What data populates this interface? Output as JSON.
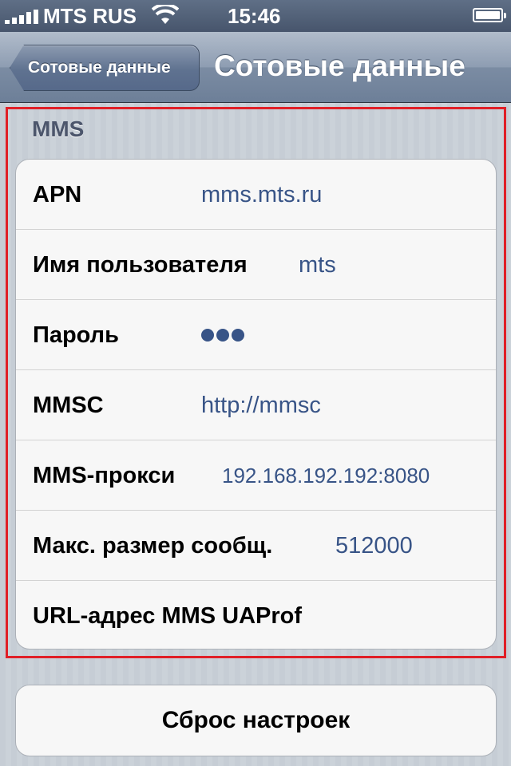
{
  "status_bar": {
    "carrier": "MTS RUS",
    "time": "15:46",
    "signal_icon": "signal-bars-icon",
    "wifi_icon": "wifi-icon",
    "battery_level": 1.0
  },
  "nav": {
    "back_label": "Сотовые данные",
    "title": "Сотовые данные"
  },
  "section": {
    "header": "MMS",
    "rows": [
      {
        "label": "APN",
        "value": "mms.mts.ru"
      },
      {
        "label": "Имя пользователя",
        "value": "mts"
      },
      {
        "label": "Пароль",
        "value": "●●●"
      },
      {
        "label": "MMSC",
        "value": "http://mmsc"
      },
      {
        "label": "MMS-прокси",
        "value": "192.168.192.192:8080"
      },
      {
        "label": "Макс. размер сообщ.",
        "value": "512000"
      },
      {
        "label": "URL-адрес MMS UAProf",
        "value": ""
      }
    ]
  },
  "reset_button": {
    "label": "Сброс настроек"
  },
  "colors": {
    "value_text": "#385487",
    "highlight_frame": "#e01f27",
    "navbar": "#6d7f98"
  }
}
